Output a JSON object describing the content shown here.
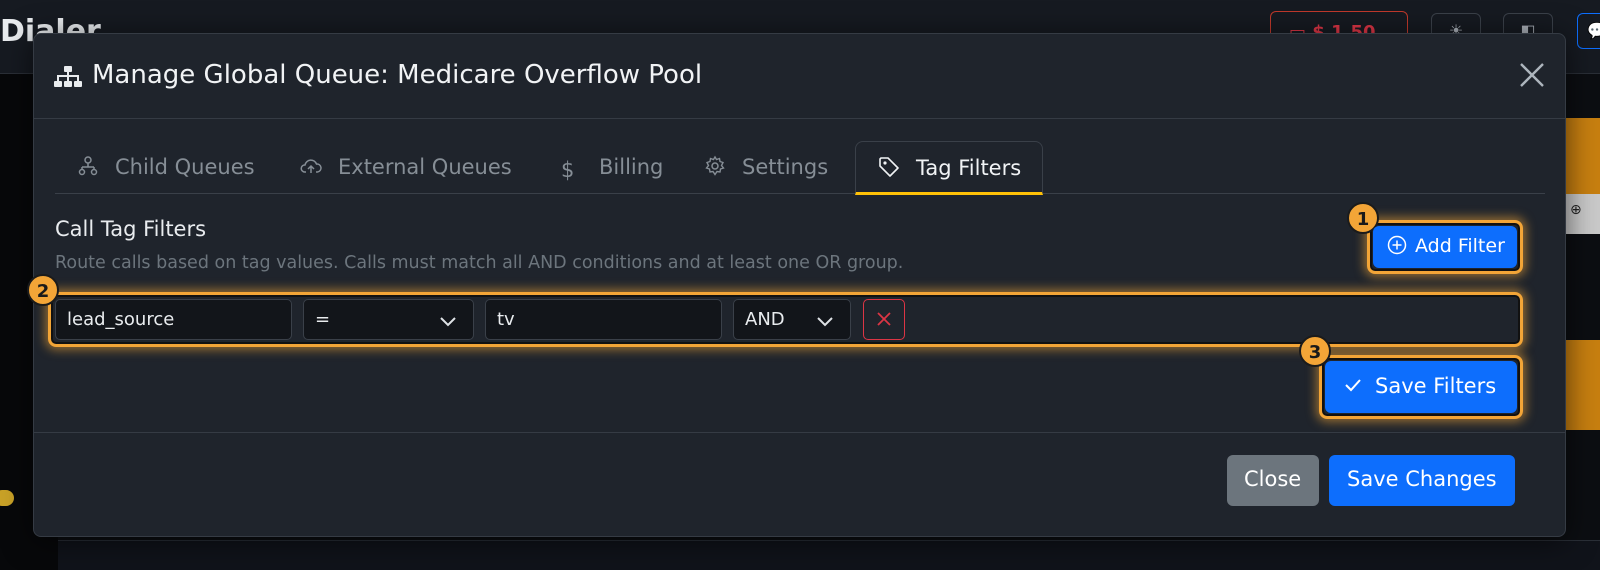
{
  "app": {
    "title": "Dialer",
    "wallet_balance": "$ 1.50"
  },
  "modal": {
    "title": "Manage Global Queue: Medicare Overflow Pool",
    "tabs": [
      {
        "label": "Child Queues",
        "icon": "sitemap-icon"
      },
      {
        "label": "External Queues",
        "icon": "cloud-upload-icon"
      },
      {
        "label": "Billing",
        "icon": "dollar-icon"
      },
      {
        "label": "Settings",
        "icon": "gear-icon"
      },
      {
        "label": "Tag Filters",
        "icon": "tag-icon",
        "active": true
      }
    ],
    "section": {
      "title": "Call Tag Filters",
      "description": "Route calls based on tag values. Calls must match all AND conditions and at least one OR group."
    },
    "add_filter_label": "Add Filter",
    "filter_row": {
      "tag": "lead_source",
      "operator": "=",
      "value": "tv",
      "logic": "AND"
    },
    "save_filters_label": "Save Filters",
    "footer": {
      "close_label": "Close",
      "save_changes_label": "Save Changes"
    }
  },
  "highlights": [
    "1",
    "2",
    "3"
  ],
  "colors": {
    "primary": "#0d6efd",
    "highlight": "#f3a537",
    "danger": "#dc3545",
    "tab_active_underline": "#ffc107"
  }
}
